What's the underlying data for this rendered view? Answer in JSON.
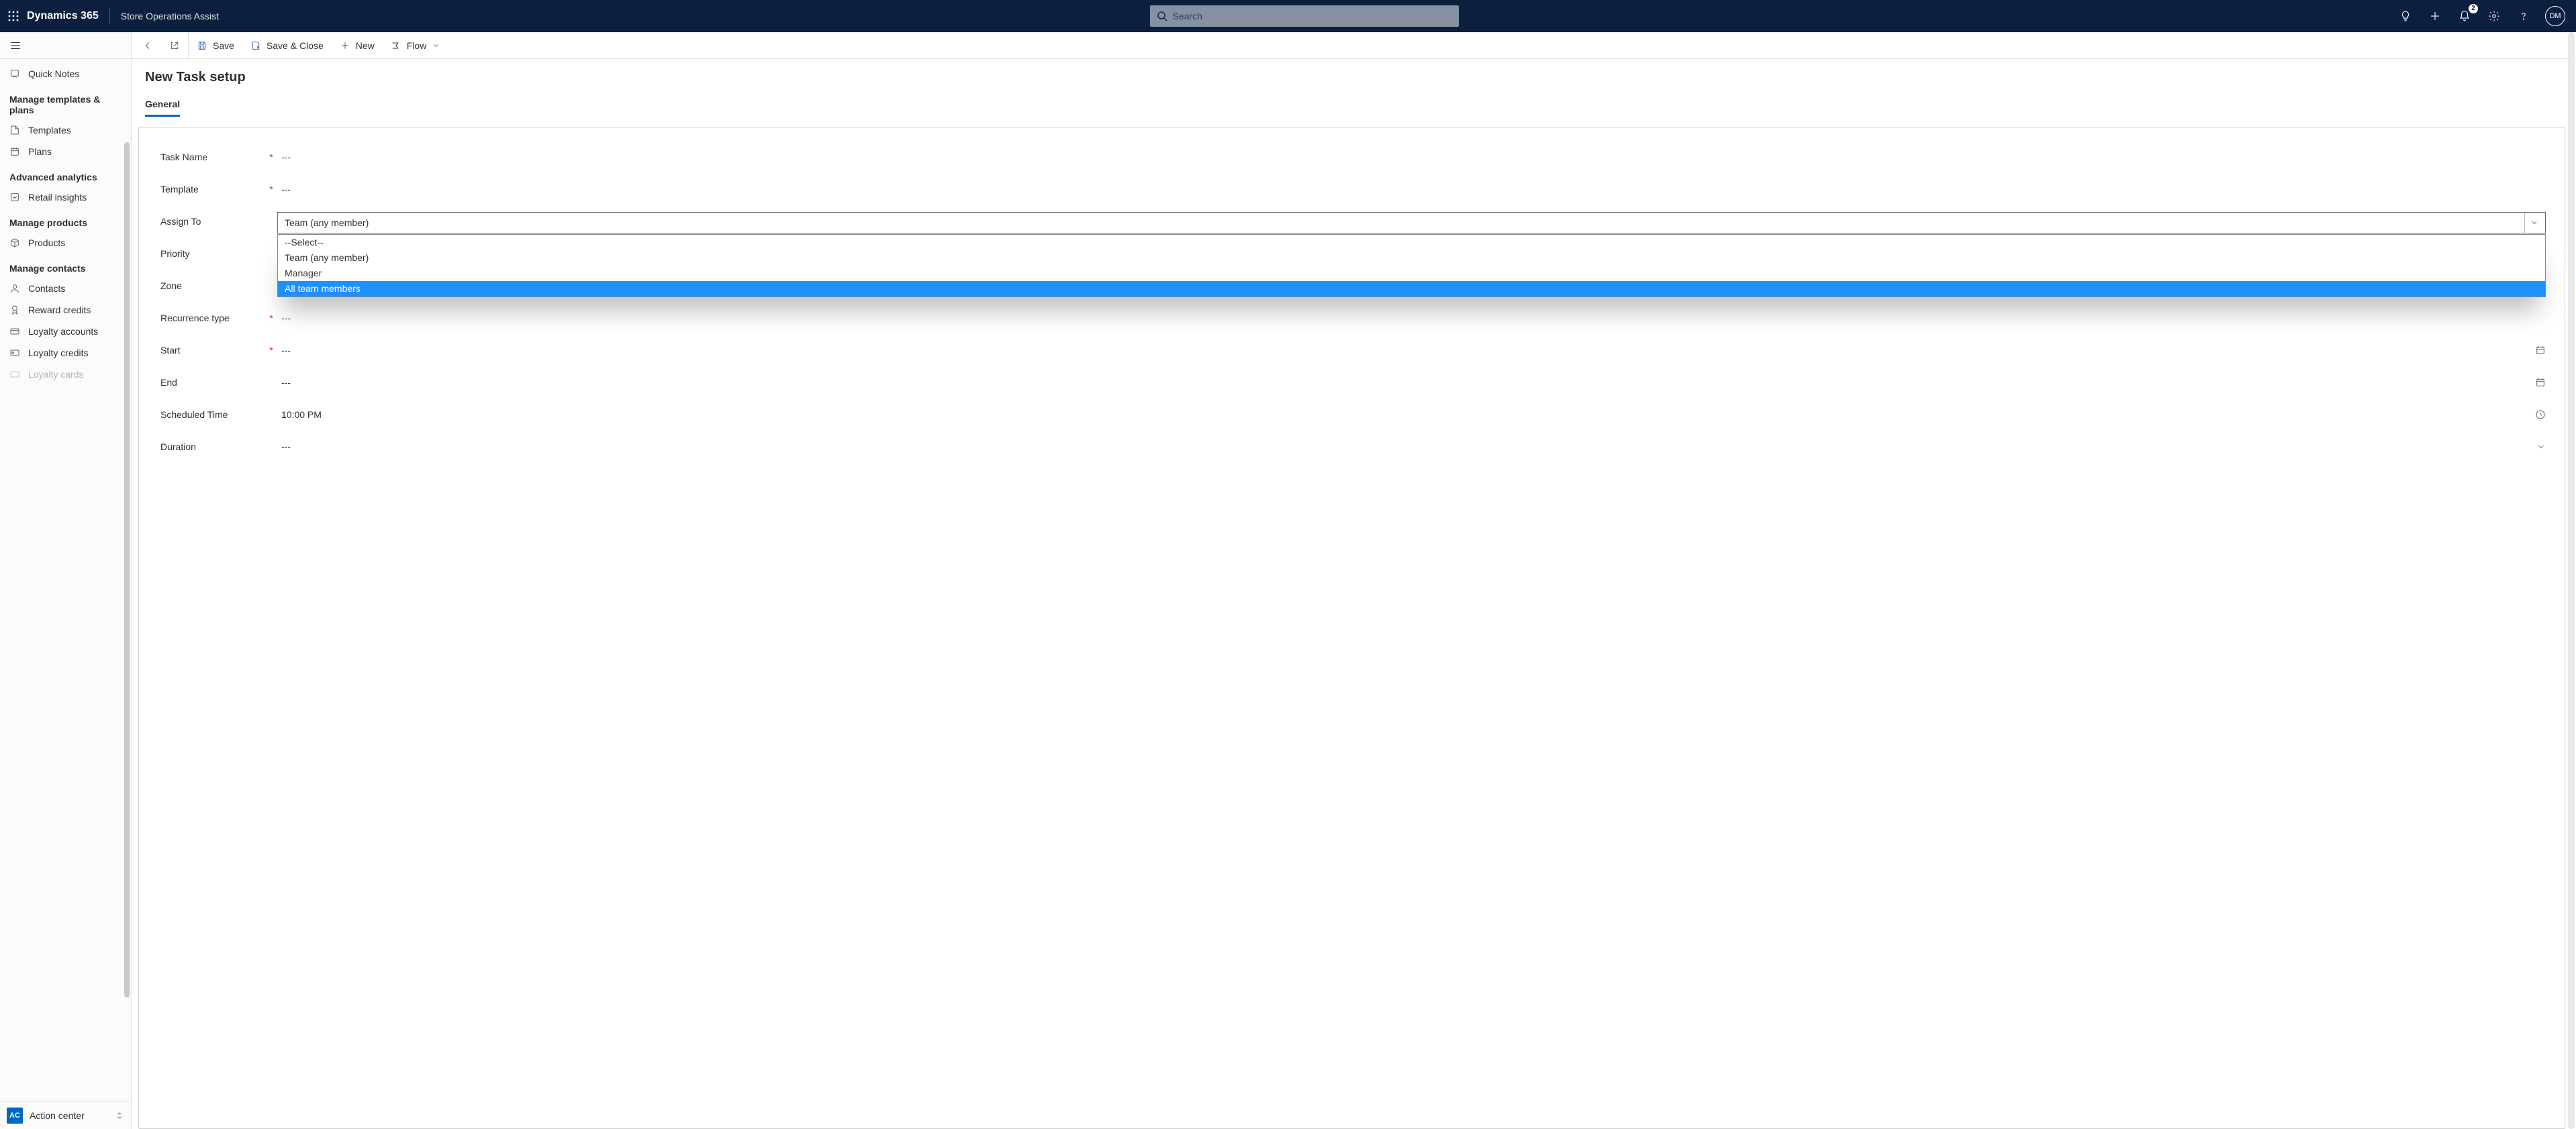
{
  "header": {
    "brand": "Dynamics 365",
    "app_name": "Store Operations Assist",
    "search_placeholder": "Search",
    "notification_count": "2",
    "avatar_initials": "DM"
  },
  "commandbar": {
    "save": "Save",
    "save_close": "Save & Close",
    "new": "New",
    "flow": "Flow"
  },
  "sidebar": {
    "quick_notes": "Quick Notes",
    "section_templates": "Manage templates & plans",
    "templates": "Templates",
    "plans": "Plans",
    "section_analytics": "Advanced analytics",
    "retail_insights": "Retail insights",
    "section_products": "Manage products",
    "products": "Products",
    "section_contacts": "Manage contacts",
    "contacts": "Contacts",
    "reward_credits": "Reward credits",
    "loyalty_accounts": "Loyalty accounts",
    "loyalty_credits": "Loyalty credits",
    "loyalty_cards": "Loyalty cards",
    "footer_badge": "AC",
    "footer_label": "Action center"
  },
  "page": {
    "title": "New Task setup",
    "tab_general": "General"
  },
  "form": {
    "task_name_label": "Task Name",
    "task_name_value": "---",
    "template_label": "Template",
    "template_value": "---",
    "assign_to_label": "Assign To",
    "assign_to_value": "Team (any member)",
    "assign_to_options": {
      "opt0": "--Select--",
      "opt1": "Team (any member)",
      "opt2": "Manager",
      "opt3": "All team members"
    },
    "priority_label": "Priority",
    "zone_label": "Zone",
    "zone_value": "---",
    "recurrence_label": "Recurrence type",
    "recurrence_value": "---",
    "start_label": "Start",
    "start_value": "---",
    "end_label": "End",
    "end_value": "---",
    "scheduled_label": "Scheduled Time",
    "scheduled_value": "10:00 PM",
    "duration_label": "Duration",
    "duration_value": "---"
  }
}
